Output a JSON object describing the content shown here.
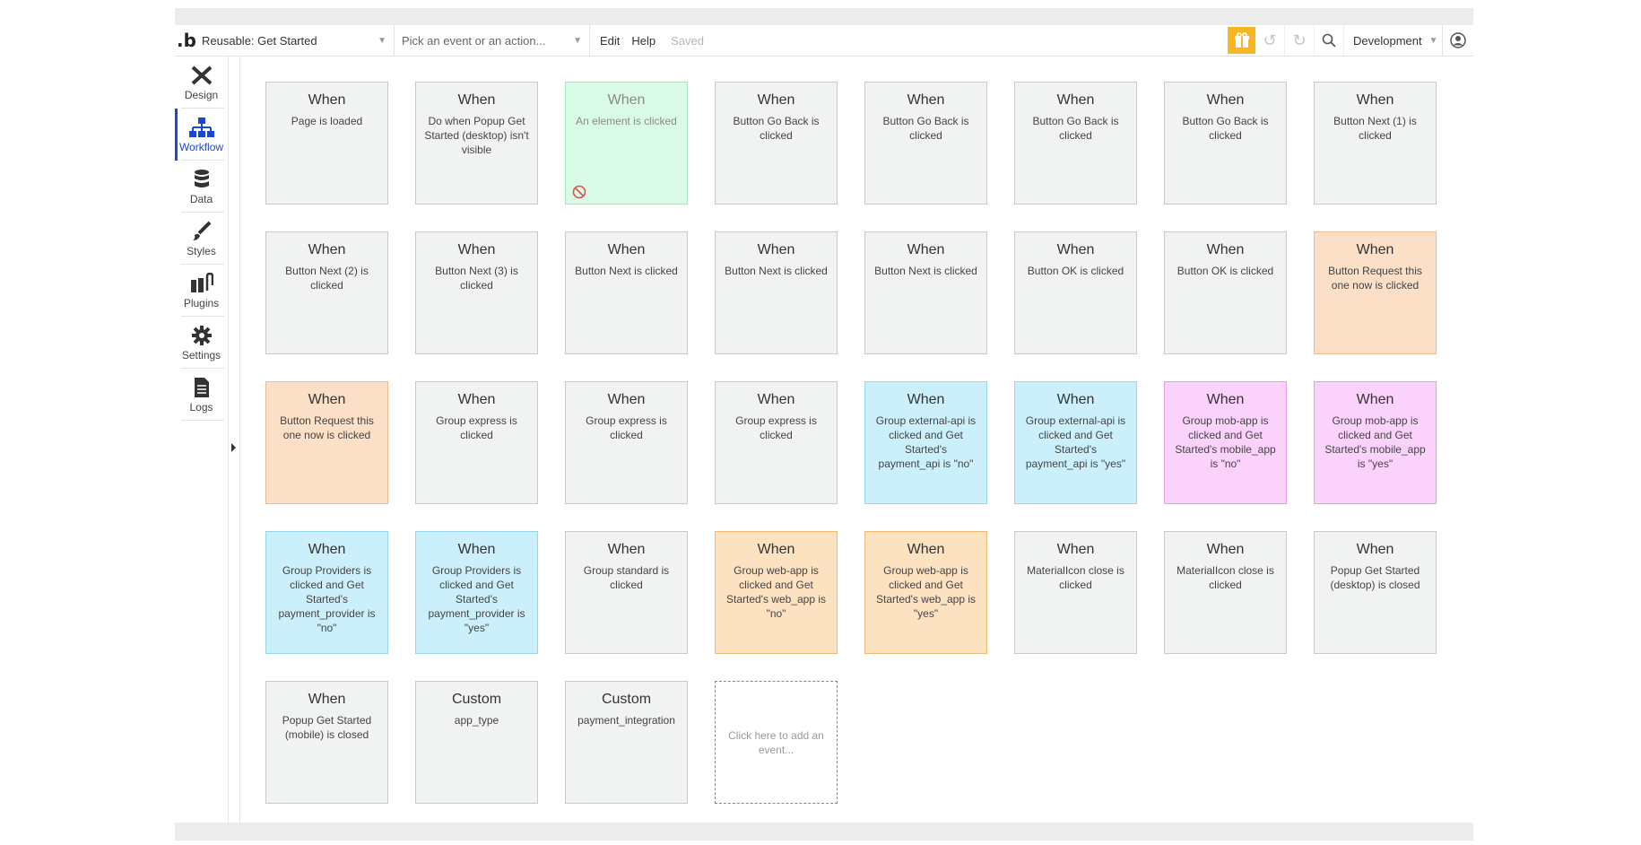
{
  "topbar": {
    "page_selector": "Reusable: Get Started",
    "event_placeholder": "Pick an event or an action...",
    "edit": "Edit",
    "help": "Help",
    "saved": "Saved",
    "environment": "Development"
  },
  "sidebar": {
    "items": [
      {
        "label": "Design",
        "icon": "design-icon"
      },
      {
        "label": "Workflow",
        "icon": "workflow-icon"
      },
      {
        "label": "Data",
        "icon": "database-icon"
      },
      {
        "label": "Styles",
        "icon": "brush-icon"
      },
      {
        "label": "Plugins",
        "icon": "plug-icon"
      },
      {
        "label": "Settings",
        "icon": "gear-icon"
      },
      {
        "label": "Logs",
        "icon": "document-icon"
      }
    ]
  },
  "colors": {
    "default": "#f1f2f2",
    "green": "#d9fae6",
    "salmon": "#fbdfc7",
    "cyan": "#ccf0fb",
    "pink": "#fbd2fb",
    "orange": "#fde2c2",
    "accent": "#1b47d8",
    "gift": "#f8b625"
  },
  "cards": [
    {
      "kw": "When",
      "desc": "Page is loaded",
      "color": "default"
    },
    {
      "kw": "When",
      "desc": "Do when Popup Get Started (desktop) isn't visible",
      "color": "default"
    },
    {
      "kw": "When",
      "desc": "An element is clicked",
      "color": "green",
      "disabled": true
    },
    {
      "kw": "When",
      "desc": "Button Go Back is clicked",
      "color": "default"
    },
    {
      "kw": "When",
      "desc": "Button Go Back is clicked",
      "color": "default"
    },
    {
      "kw": "When",
      "desc": "Button Go Back is clicked",
      "color": "default"
    },
    {
      "kw": "When",
      "desc": "Button Go Back is clicked",
      "color": "default"
    },
    {
      "kw": "When",
      "desc": "Button Next (1) is clicked",
      "color": "default"
    },
    {
      "kw": "When",
      "desc": "Button Next (2) is clicked",
      "color": "default"
    },
    {
      "kw": "When",
      "desc": "Button Next (3) is clicked",
      "color": "default"
    },
    {
      "kw": "When",
      "desc": "Button Next is clicked",
      "color": "default"
    },
    {
      "kw": "When",
      "desc": "Button Next is clicked",
      "color": "default"
    },
    {
      "kw": "When",
      "desc": "Button Next is clicked",
      "color": "default"
    },
    {
      "kw": "When",
      "desc": "Button OK is clicked",
      "color": "default"
    },
    {
      "kw": "When",
      "desc": "Button OK is clicked",
      "color": "default"
    },
    {
      "kw": "When",
      "desc": "Button Request this one now is clicked",
      "color": "salmon"
    },
    {
      "kw": "When",
      "desc": "Button Request this one now is clicked",
      "color": "salmon"
    },
    {
      "kw": "When",
      "desc": "Group express is clicked",
      "color": "default"
    },
    {
      "kw": "When",
      "desc": "Group express is clicked",
      "color": "default"
    },
    {
      "kw": "When",
      "desc": "Group express is clicked",
      "color": "default"
    },
    {
      "kw": "When",
      "desc": "Group external-api is clicked and Get Started's payment_api is \"no\"",
      "color": "cyan"
    },
    {
      "kw": "When",
      "desc": "Group external-api is clicked and Get Started's payment_api is \"yes\"",
      "color": "cyan"
    },
    {
      "kw": "When",
      "desc": "Group mob-app is clicked and Get Started's mobile_app is \"no\"",
      "color": "pink"
    },
    {
      "kw": "When",
      "desc": "Group mob-app is clicked and Get Started's mobile_app is \"yes\"",
      "color": "pink"
    },
    {
      "kw": "When",
      "desc": "Group Providers is clicked and Get Started's payment_provider is \"no\"",
      "color": "cyan"
    },
    {
      "kw": "When",
      "desc": "Group Providers is clicked and Get Started's payment_provider is \"yes\"",
      "color": "cyan"
    },
    {
      "kw": "When",
      "desc": "Group standard is clicked",
      "color": "default"
    },
    {
      "kw": "When",
      "desc": "Group web-app is clicked and Get Started's web_app is \"no\"",
      "color": "orange"
    },
    {
      "kw": "When",
      "desc": "Group web-app is clicked and Get Started's web_app is \"yes\"",
      "color": "orange"
    },
    {
      "kw": "When",
      "desc": "MaterialIcon close is clicked",
      "color": "default"
    },
    {
      "kw": "When",
      "desc": "MaterialIcon close is clicked",
      "color": "default"
    },
    {
      "kw": "When",
      "desc": "Popup Get Started (desktop) is closed",
      "color": "default"
    },
    {
      "kw": "When",
      "desc": "Popup Get Started (mobile) is closed",
      "color": "default"
    },
    {
      "kw": "Custom",
      "desc": "app_type",
      "color": "default"
    },
    {
      "kw": "Custom",
      "desc": "payment_integration",
      "color": "default"
    }
  ],
  "add_event_text": "Click here to add an event..."
}
